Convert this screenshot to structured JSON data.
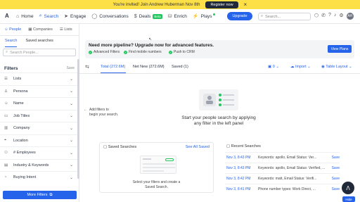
{
  "banner": {
    "text": "You're invited! Join Andrew Huberman Nov 8th",
    "register_label": "Register now",
    "close_icon": "close-icon"
  },
  "nav": {
    "items": [
      {
        "label": "Home",
        "icon": "home-icon"
      },
      {
        "label": "Search",
        "icon": "search-icon"
      },
      {
        "label": "Engage",
        "icon": "send-icon"
      },
      {
        "label": "Conversations",
        "icon": "chat-icon"
      },
      {
        "label": "Deals",
        "icon": "dollar-icon",
        "badge": "Beta"
      },
      {
        "label": "Enrich",
        "icon": "database-icon"
      },
      {
        "label": "Plays",
        "icon": "bolt-icon"
      }
    ],
    "upgrade_label": "Upgrade",
    "search_placeholder": "Search...",
    "avatar_initials": "AH"
  },
  "sidebar": {
    "subnav": [
      "People",
      "Companies",
      "Lists"
    ],
    "tabs": [
      "Search",
      "Saved searches"
    ],
    "people_search_placeholder": "Search People...",
    "filters_title": "Filters",
    "save_label": "Save",
    "filters": [
      {
        "label": "Lists",
        "icon": "list-icon"
      },
      {
        "label": "Persona",
        "icon": "persona-icon"
      },
      {
        "label": "Name",
        "icon": "person-icon"
      },
      {
        "label": "Job Titles",
        "icon": "briefcase-icon"
      },
      {
        "label": "Company",
        "icon": "building-icon"
      },
      {
        "label": "Location",
        "icon": "location-icon"
      },
      {
        "label": "# Employees",
        "icon": "users-icon"
      },
      {
        "label": "Industry & Keywords",
        "icon": "industry-icon"
      },
      {
        "label": "Buying Intent",
        "icon": "intent-icon"
      }
    ],
    "more_filters_label": "More Filters"
  },
  "upsell": {
    "heading": "Need more pipeline? Upgrade now for advanced features.",
    "features": [
      "Advanced Filters",
      "Find mobile numbers",
      "Push to CRM"
    ],
    "view_plans_label": "View Plans"
  },
  "results_tabs": {
    "total": "Total (272.6M)",
    "net_new": "Net New (272.6M)",
    "saved": "Saved (1)",
    "list_count": "0",
    "import_label": "Import",
    "layout_label": "Table Layout"
  },
  "hint": {
    "line1": "Add filters to",
    "line2": "begin your search."
  },
  "empty_state": {
    "line1": "Start your people search by applying",
    "line2": "any filter in the left panel"
  },
  "saved_searches": {
    "title": "Saved Searches",
    "see_all": "See All Saved",
    "text_line1": "Select your filters and create a",
    "text_line2": "Saved Search."
  },
  "recent_searches": {
    "title": "Recent Searches",
    "rows": [
      {
        "date": "Nov 3, 8:43 PM",
        "query": "Keywords: apollo, Email Status: Ver...",
        "save": "Save"
      },
      {
        "date": "Nov 3, 8:43 PM",
        "query": "Keywords: apollo, Email Status: Verified, ...",
        "save": "Save"
      },
      {
        "date": "Nov 3, 8:42 PM",
        "query": "Keywords: matt, Email Status: Verifi...",
        "save": "Save"
      },
      {
        "date": "Nov 3, 8:41 PM",
        "query": "Phone number types: Work Direct, ...",
        "save": "Save"
      }
    ]
  },
  "fab": {
    "hide_label": "Hide"
  }
}
